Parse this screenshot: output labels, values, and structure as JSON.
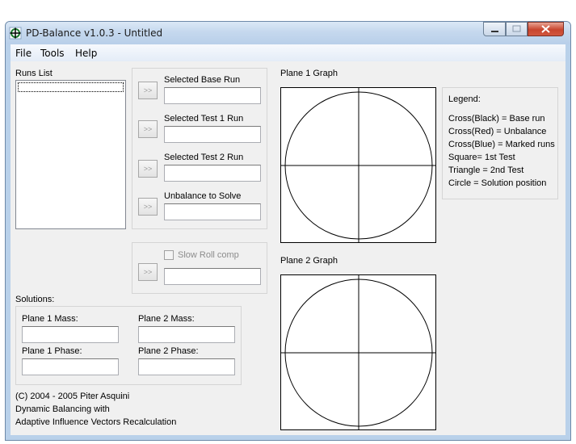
{
  "window": {
    "title": "PD-Balance v1.0.3 - Untitled"
  },
  "menu": [
    "File",
    "Tools",
    "Help"
  ],
  "runs": {
    "label": "Runs List"
  },
  "selectors": {
    "base_label": "Selected Base Run",
    "test1_label": "Selected Test 1 Run",
    "test2_label": "Selected Test 2 Run",
    "unbalance_label": "Unbalance to Solve",
    "arrow": ">>",
    "slow_roll_label": "Slow Roll comp"
  },
  "solutions": {
    "label": "Solutions:",
    "plane1_mass": "Plane 1 Mass:",
    "plane2_mass": "Plane 2 Mass:",
    "plane1_phase": "Plane 1 Phase:",
    "plane2_phase": "Plane 2 Phase:"
  },
  "graphs": {
    "plane1_label": "Plane 1 Graph",
    "plane2_label": "Plane 2 Graph"
  },
  "legend": {
    "title": "Legend:",
    "lines": [
      "Cross(Black) = Base run",
      "Cross(Red) = Unbalance",
      "Cross(Blue) = Marked runs",
      "Square= 1st Test",
      "Triangle = 2nd Test",
      "Circle = Solution position"
    ]
  },
  "footer": [
    "(C) 2004 - 2005 Piter Asquini",
    "Dynamic Balancing with",
    "Adaptive Influence Vectors Recalculation"
  ],
  "colors": {
    "title_bar": "#c5d8ee",
    "close_button": "#c8452e",
    "client_bg": "#f0f0f0"
  }
}
